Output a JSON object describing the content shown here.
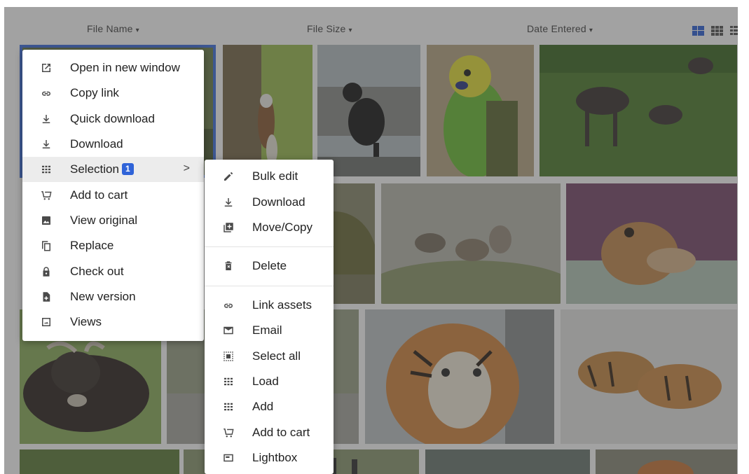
{
  "sort_header": {
    "columns": [
      {
        "label": "File Name",
        "caret": "▾"
      },
      {
        "label": "File Size",
        "caret": "▾"
      },
      {
        "label": "Date Entered",
        "caret": "▾"
      }
    ],
    "views": [
      "mosaic-view-icon",
      "grid-view-icon",
      "list-view-icon"
    ]
  },
  "grid": {
    "tiles": [
      "squirrel",
      "black-cat",
      "budgerigar",
      "moose",
      "turtle",
      "wolves",
      "dog-under-blanket",
      "yak",
      "tiger",
      "tigers-snow"
    ],
    "selected_count": "1"
  },
  "context_menu": {
    "items": [
      {
        "label": "Open in new window",
        "icon": "open-new-window-icon"
      },
      {
        "label": "Copy link",
        "icon": "link-icon"
      },
      {
        "label": "Quick download",
        "icon": "download-icon"
      },
      {
        "label": "Download",
        "icon": "download-icon"
      },
      {
        "label": "Selection",
        "icon": "grid-icon",
        "badge": "1",
        "chevron": ">"
      },
      {
        "label": "Add to cart",
        "icon": "cart-icon"
      },
      {
        "label": "View original",
        "icon": "image-icon"
      },
      {
        "label": "Replace",
        "icon": "copy-icon"
      },
      {
        "label": "Check out",
        "icon": "lock-icon"
      },
      {
        "label": "New version",
        "icon": "new-file-icon"
      },
      {
        "label": "Views",
        "icon": "views-icon"
      }
    ]
  },
  "submenu": {
    "items": [
      {
        "label": "Bulk edit",
        "icon": "pencil-icon"
      },
      {
        "label": "Download",
        "icon": "download-icon"
      },
      {
        "label": "Move/Copy",
        "icon": "move-copy-icon"
      },
      {
        "label": "Delete",
        "icon": "trash-icon"
      },
      {
        "label": "Link assets",
        "icon": "link-icon"
      },
      {
        "label": "Email",
        "icon": "email-icon"
      },
      {
        "label": "Select all",
        "icon": "select-all-icon"
      },
      {
        "label": "Load",
        "icon": "grid-icon"
      },
      {
        "label": "Add",
        "icon": "grid-icon"
      },
      {
        "label": "Add to cart",
        "icon": "cart-icon"
      },
      {
        "label": "Lightbox",
        "icon": "lightbox-icon"
      }
    ]
  },
  "colors": {
    "accent": "#2f63d8",
    "selection_ring": "#3f6fe0"
  }
}
